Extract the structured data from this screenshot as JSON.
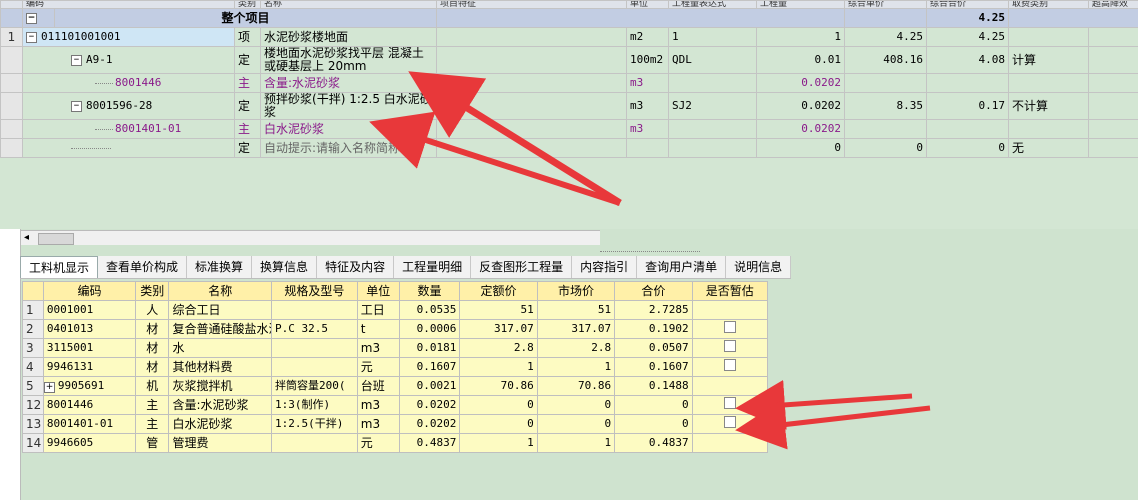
{
  "top": {
    "header": [
      "编码",
      "类别",
      "名称",
      "项目特征",
      "单位",
      "工程量表达式",
      "工程量",
      "综合单价",
      "综合合价",
      "取费类别",
      "超高降效"
    ],
    "group": {
      "label": "整个项目",
      "total": "4.25"
    },
    "rows": [
      {
        "rn": "1",
        "code": "011101001001",
        "type": "项",
        "name": "水泥砂浆楼地面",
        "unit": "m2",
        "expr": "1",
        "qty": "1",
        "price": "4.25",
        "total": "4.25",
        "fee": ""
      },
      {
        "rn": "",
        "code": "A9-1",
        "type": "定",
        "name": "楼地面水泥砂浆找平层 混凝土或硬基层上 20mm",
        "unit": "100m2",
        "expr": "QDL",
        "qty": "0.01",
        "price": "408.16",
        "total": "4.08",
        "fee": "计算"
      },
      {
        "rn": "",
        "code": "8001446",
        "type": "主",
        "name": "含量:水泥砂浆",
        "unit": "m3",
        "expr": "",
        "qty": "0.0202",
        "price": "",
        "total": "",
        "fee": ""
      },
      {
        "rn": "",
        "code": "8001596-28",
        "type": "定",
        "name": "预拌砂浆(干拌) 1:2.5 白水泥砂浆",
        "unit": "m3",
        "expr": "SJ2",
        "qty": "0.0202",
        "price": "8.35",
        "total": "0.17",
        "fee": "不计算"
      },
      {
        "rn": "",
        "code": "8001401-01",
        "type": "主",
        "name": "白水泥砂浆",
        "unit": "m3",
        "expr": "",
        "qty": "0.0202",
        "price": "",
        "total": "",
        "fee": ""
      },
      {
        "rn": "",
        "code": "",
        "type": "定",
        "name": "自动提示:请输入名称简称",
        "unit": "",
        "expr": "",
        "qty": "0",
        "price": "0",
        "total": "0",
        "fee": "无"
      }
    ]
  },
  "tabs": [
    "工料机显示",
    "查看单价构成",
    "标准换算",
    "换算信息",
    "特征及内容",
    "工程量明细",
    "反查图形工程量",
    "内容指引",
    "查询用户清单",
    "说明信息"
  ],
  "bottom": {
    "header": [
      "",
      "编码",
      "类别",
      "名称",
      "规格及型号",
      "单位",
      "数量",
      "定额价",
      "市场价",
      "合价",
      "是否暂估"
    ],
    "rows": [
      {
        "rn": "1",
        "code": "0001001",
        "type": "人",
        "name": "综合工日",
        "spec": "",
        "unit": "工日",
        "qty": "0.0535",
        "quota": "51",
        "market": "51",
        "total": "2.7285",
        "chk": false
      },
      {
        "rn": "2",
        "code": "0401013",
        "type": "材",
        "name": "复合普通硅酸盐水泥",
        "spec": "P.C 32.5",
        "unit": "t",
        "qty": "0.0006",
        "quota": "317.07",
        "market": "317.07",
        "total": "0.1902",
        "chk": true
      },
      {
        "rn": "3",
        "code": "3115001",
        "type": "材",
        "name": "水",
        "spec": "",
        "unit": "m3",
        "qty": "0.0181",
        "quota": "2.8",
        "market": "2.8",
        "total": "0.0507",
        "chk": true
      },
      {
        "rn": "4",
        "code": "9946131",
        "type": "材",
        "name": "其他材料费",
        "spec": "",
        "unit": "元",
        "qty": "0.1607",
        "quota": "1",
        "market": "1",
        "total": "0.1607",
        "chk": true
      },
      {
        "rn": "5",
        "code": "9905691",
        "type": "机",
        "name": "灰浆搅拌机",
        "spec": "拌筒容量200(",
        "unit": "台班",
        "qty": "0.0021",
        "quota": "70.86",
        "market": "70.86",
        "total": "0.1488",
        "chk": false
      },
      {
        "rn": "12",
        "code": "8001446",
        "type": "主",
        "name": "含量:水泥砂浆",
        "spec": "1:3(制作)",
        "unit": "m3",
        "qty": "0.0202",
        "quota": "0",
        "market": "0",
        "total": "0",
        "chk": true
      },
      {
        "rn": "13",
        "code": "8001401-01",
        "type": "主",
        "name": "白水泥砂浆",
        "spec": "1:2.5(干拌)",
        "unit": "m3",
        "qty": "0.0202",
        "quota": "0",
        "market": "0",
        "total": "0",
        "chk": true
      },
      {
        "rn": "14",
        "code": "9946605",
        "type": "管",
        "name": "管理费",
        "spec": "",
        "unit": "元",
        "qty": "0.4837",
        "quota": "1",
        "market": "1",
        "total": "0.4837",
        "chk": false
      }
    ]
  },
  "colors": {
    "arrow": "#e8383a"
  }
}
